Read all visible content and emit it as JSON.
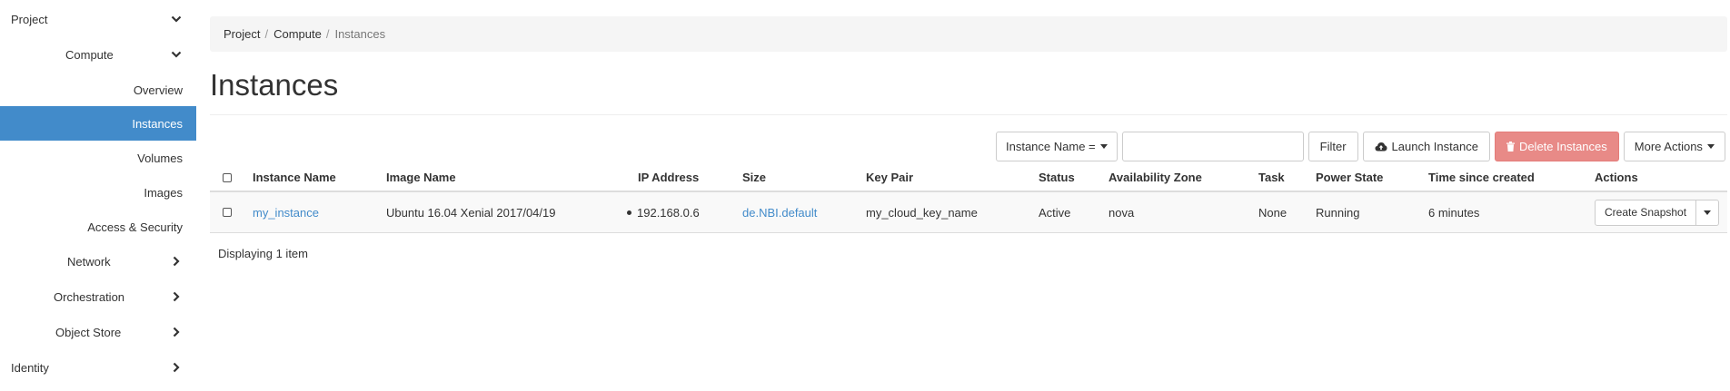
{
  "sidebar": {
    "project": "Project",
    "compute": "Compute",
    "overview": "Overview",
    "instances": "Instances",
    "volumes": "Volumes",
    "images": "Images",
    "access_security": "Access & Security",
    "network": "Network",
    "orchestration": "Orchestration",
    "object_store": "Object Store",
    "identity": "Identity",
    "active_color": "#428bca"
  },
  "breadcrumb": {
    "items": [
      "Project",
      "Compute",
      "Instances"
    ],
    "separator": "/"
  },
  "page": {
    "title": "Instances"
  },
  "toolbar": {
    "filter_field": "Instance Name =",
    "filter_value": "",
    "filter_button": "Filter",
    "launch_button": "Launch Instance",
    "delete_button": "Delete Instances",
    "more_actions": "More Actions",
    "danger_color": "#e88a87"
  },
  "table": {
    "headers": {
      "name": "Instance Name",
      "image": "Image Name",
      "ip": "IP Address",
      "size": "Size",
      "keypair": "Key Pair",
      "status": "Status",
      "zone": "Availability Zone",
      "task": "Task",
      "power": "Power State",
      "time": "Time since created",
      "actions": "Actions"
    },
    "rows": [
      {
        "name": "my_instance",
        "image": "Ubuntu 16.04 Xenial 2017/04/19",
        "ip": "192.168.0.6",
        "size": "de.NBI.default",
        "keypair": "my_cloud_key_name",
        "status": "Active",
        "zone": "nova",
        "task": "None",
        "power": "Running",
        "time": "6 minutes",
        "action": "Create Snapshot"
      }
    ],
    "footer": "Displaying 1 item"
  }
}
